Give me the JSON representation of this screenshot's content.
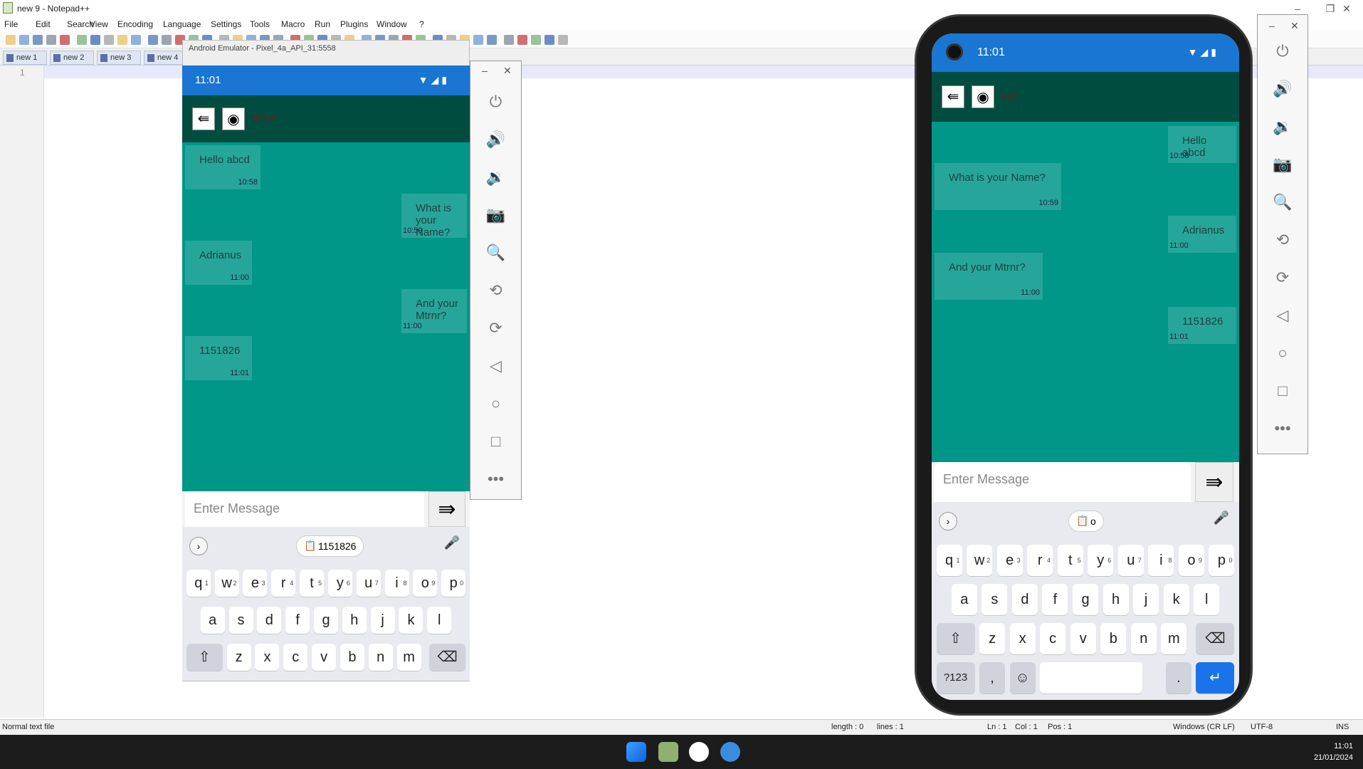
{
  "window": {
    "title": "new 9 - Notepad++",
    "min": "–",
    "max": "❐",
    "close": "✕"
  },
  "menu": [
    "File",
    "Edit",
    "Search",
    "View",
    "Encoding",
    "Language",
    "Settings",
    "Tools",
    "Macro",
    "Run",
    "Plugins",
    "Window",
    "?"
  ],
  "tabs": [
    "new 1",
    "new 2",
    "new 3",
    "new 4"
  ],
  "editor": {
    "line": "1"
  },
  "status": {
    "type": "Normal text file",
    "length": "length : 0",
    "lines": "lines : 1",
    "ln": "Ln : 1",
    "col": "Col : 1",
    "pos": "Pos : 1",
    "eol": "Windows (CR LF)",
    "enc": "UTF-8",
    "ins": "INS"
  },
  "taskbar": {
    "time": "11:01",
    "date": "21/01/2024"
  },
  "emu1": {
    "title": "Android Emulator - Pixel_4a_API_31:5558",
    "time": "11:01",
    "contact": "abcd",
    "messages": [
      {
        "text": "Hello abcd",
        "time": "10:58",
        "side": "left"
      },
      {
        "text": "What is your Name?",
        "time": "10:59",
        "side": "right"
      },
      {
        "text": "Adrianus",
        "time": "11:00",
        "side": "left"
      },
      {
        "text": "And your Mtrnr?",
        "time": "11:00",
        "side": "right"
      },
      {
        "text": "1151826",
        "time": "11:01",
        "side": "left"
      }
    ],
    "placeholder": "Enter Message",
    "clip": "1151826"
  },
  "emu2": {
    "time": "11:01",
    "contact": "xyz",
    "messages": [
      {
        "text": "Hello abcd",
        "time": "10:58",
        "side": "right"
      },
      {
        "text": "What is your Name?",
        "time": "10:59",
        "side": "left"
      },
      {
        "text": "Adrianus",
        "time": "11:00",
        "side": "right"
      },
      {
        "text": "And your Mtrnr?",
        "time": "11:00",
        "side": "left"
      },
      {
        "text": "1151826",
        "time": "11:01",
        "side": "right"
      }
    ],
    "placeholder": "Enter Message",
    "clip": "o"
  },
  "keyboard": {
    "row1": [
      "q",
      "w",
      "e",
      "r",
      "t",
      "y",
      "u",
      "i",
      "o",
      "p"
    ],
    "row1sup": [
      "1",
      "2",
      "3",
      "4",
      "5",
      "6",
      "7",
      "8",
      "9",
      "0"
    ],
    "row2": [
      "a",
      "s",
      "d",
      "f",
      "g",
      "h",
      "j",
      "k",
      "l"
    ],
    "row3": [
      "z",
      "x",
      "c",
      "v",
      "b",
      "n",
      "m"
    ],
    "sym": "?123",
    "comma": ",",
    "dot": "."
  },
  "side_icons": [
    "power-icon",
    "volume-up-icon",
    "volume-down-icon",
    "camera-icon",
    "zoom-icon",
    "rotate-left-icon",
    "rotate-right-icon",
    "back-icon",
    "home-icon",
    "overview-icon",
    "more-icon"
  ],
  "colors": {
    "statusbar": "#1976d2",
    "appbar": "#004d40",
    "chat": "#009688",
    "bubble": "#26a69a",
    "accent": "#1a73e8"
  }
}
